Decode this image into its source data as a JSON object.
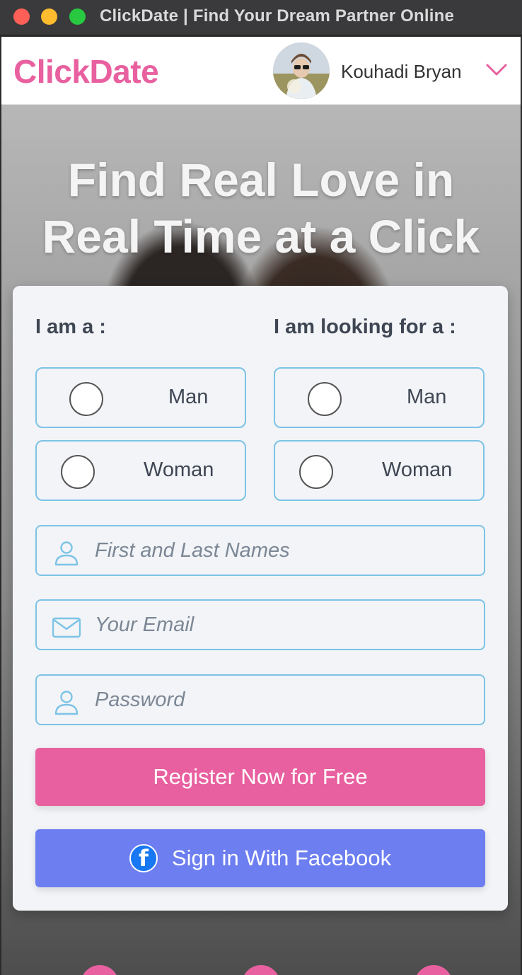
{
  "window": {
    "title": "ClickDate | Find Your Dream Partner Online"
  },
  "navbar": {
    "brand": "ClickDate",
    "user_name": "Kouhadi Bryan",
    "brand_color": "#e8609f"
  },
  "hero": {
    "title_line1": "Find Real Love in",
    "title_line2": "Real Time at a Click"
  },
  "form": {
    "i_am_label": "I am a :",
    "looking_for_label": "I am looking for a :",
    "i_am_options": [
      "Man",
      "Woman"
    ],
    "looking_for_options": [
      "Man",
      "Woman"
    ],
    "name_placeholder": "First and Last Names",
    "email_placeholder": "Your Email",
    "password_placeholder": "Password",
    "register_label": "Register Now for Free",
    "facebook_label": "Sign in With Facebook",
    "register_color": "#e8609f",
    "facebook_color": "#6c7ef0",
    "field_border_color": "#7cc3e6"
  },
  "icons": {
    "name_field": "user-icon",
    "email_field": "envelope-icon",
    "password_field": "user-icon",
    "facebook": "facebook-icon"
  }
}
